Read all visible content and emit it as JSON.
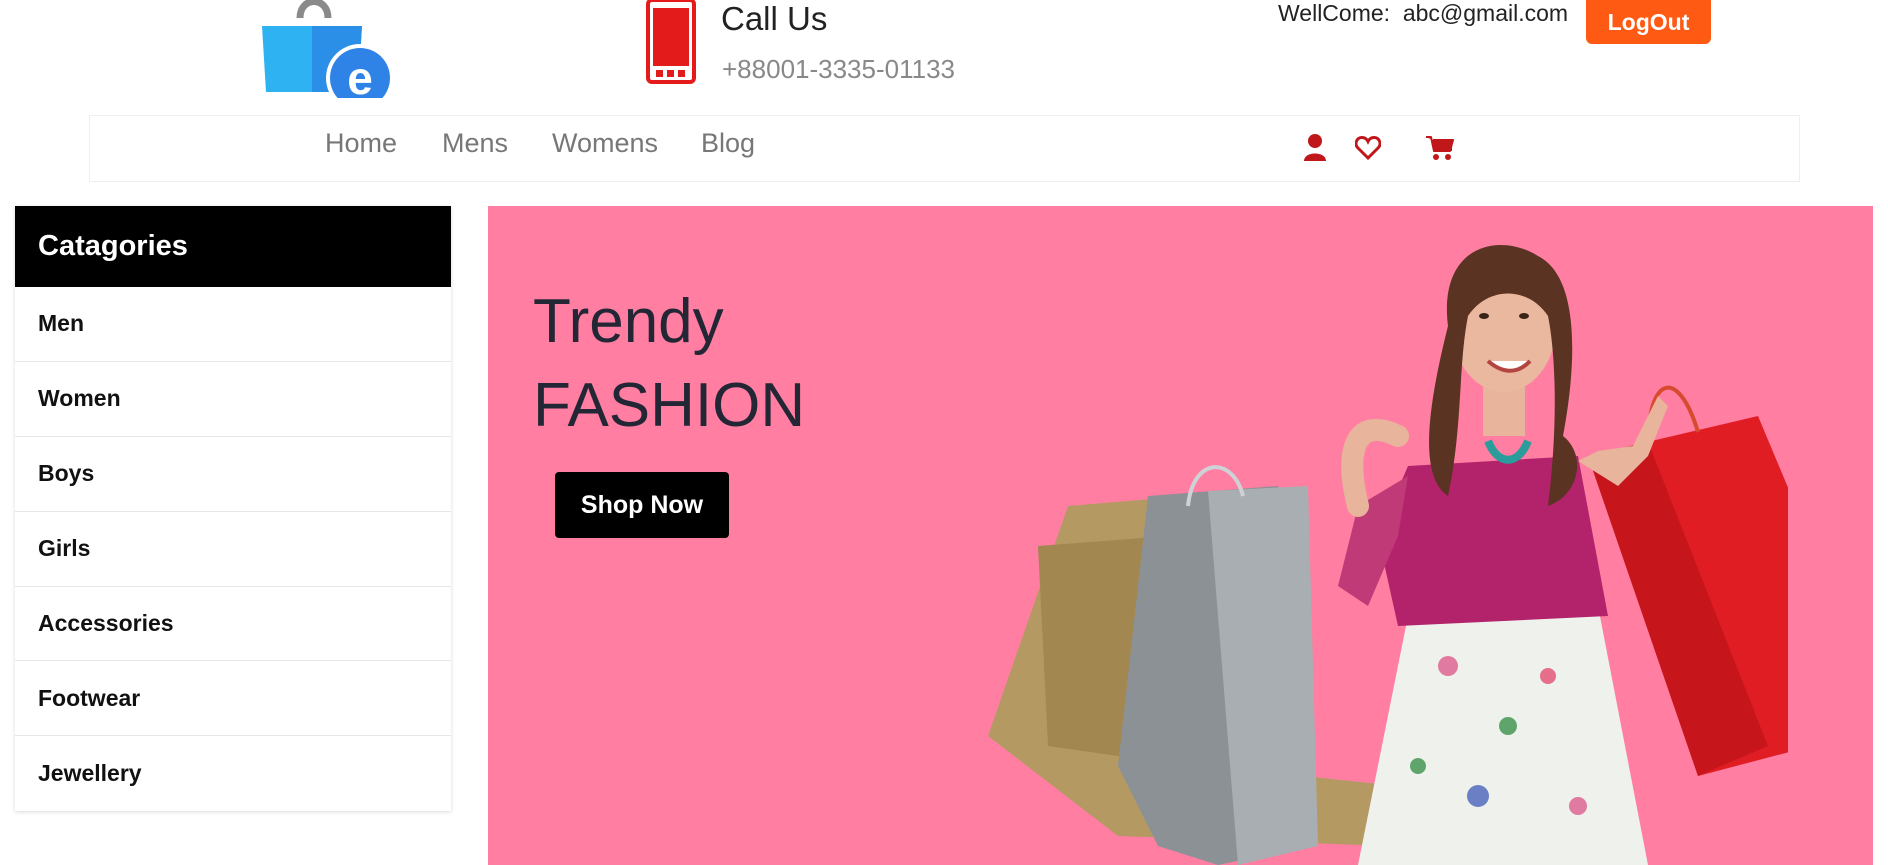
{
  "header": {
    "call_title": "Call Us",
    "call_number": "+88001-3335-01133",
    "welcome_label": "WellCome:",
    "user_email": "abc@gmail.com",
    "logout_label": "LogOut"
  },
  "nav": {
    "links": [
      "Home",
      "Mens",
      "Womens",
      "Blog"
    ],
    "icons": [
      "user-icon",
      "heart-icon",
      "cart-icon"
    ]
  },
  "sidebar": {
    "title": "Catagories",
    "items": [
      "Men",
      "Women",
      "Boys",
      "Girls",
      "Accessories",
      "Footwear",
      "Jewellery"
    ]
  },
  "banner": {
    "line1": "Trendy",
    "line2": "FASHION",
    "button_label": "Shop Now",
    "background_color": "#ff7ea1"
  },
  "colors": {
    "accent": "#ff5a14",
    "icon_red": "#c0171b",
    "phone_red": "#e41b1b"
  }
}
